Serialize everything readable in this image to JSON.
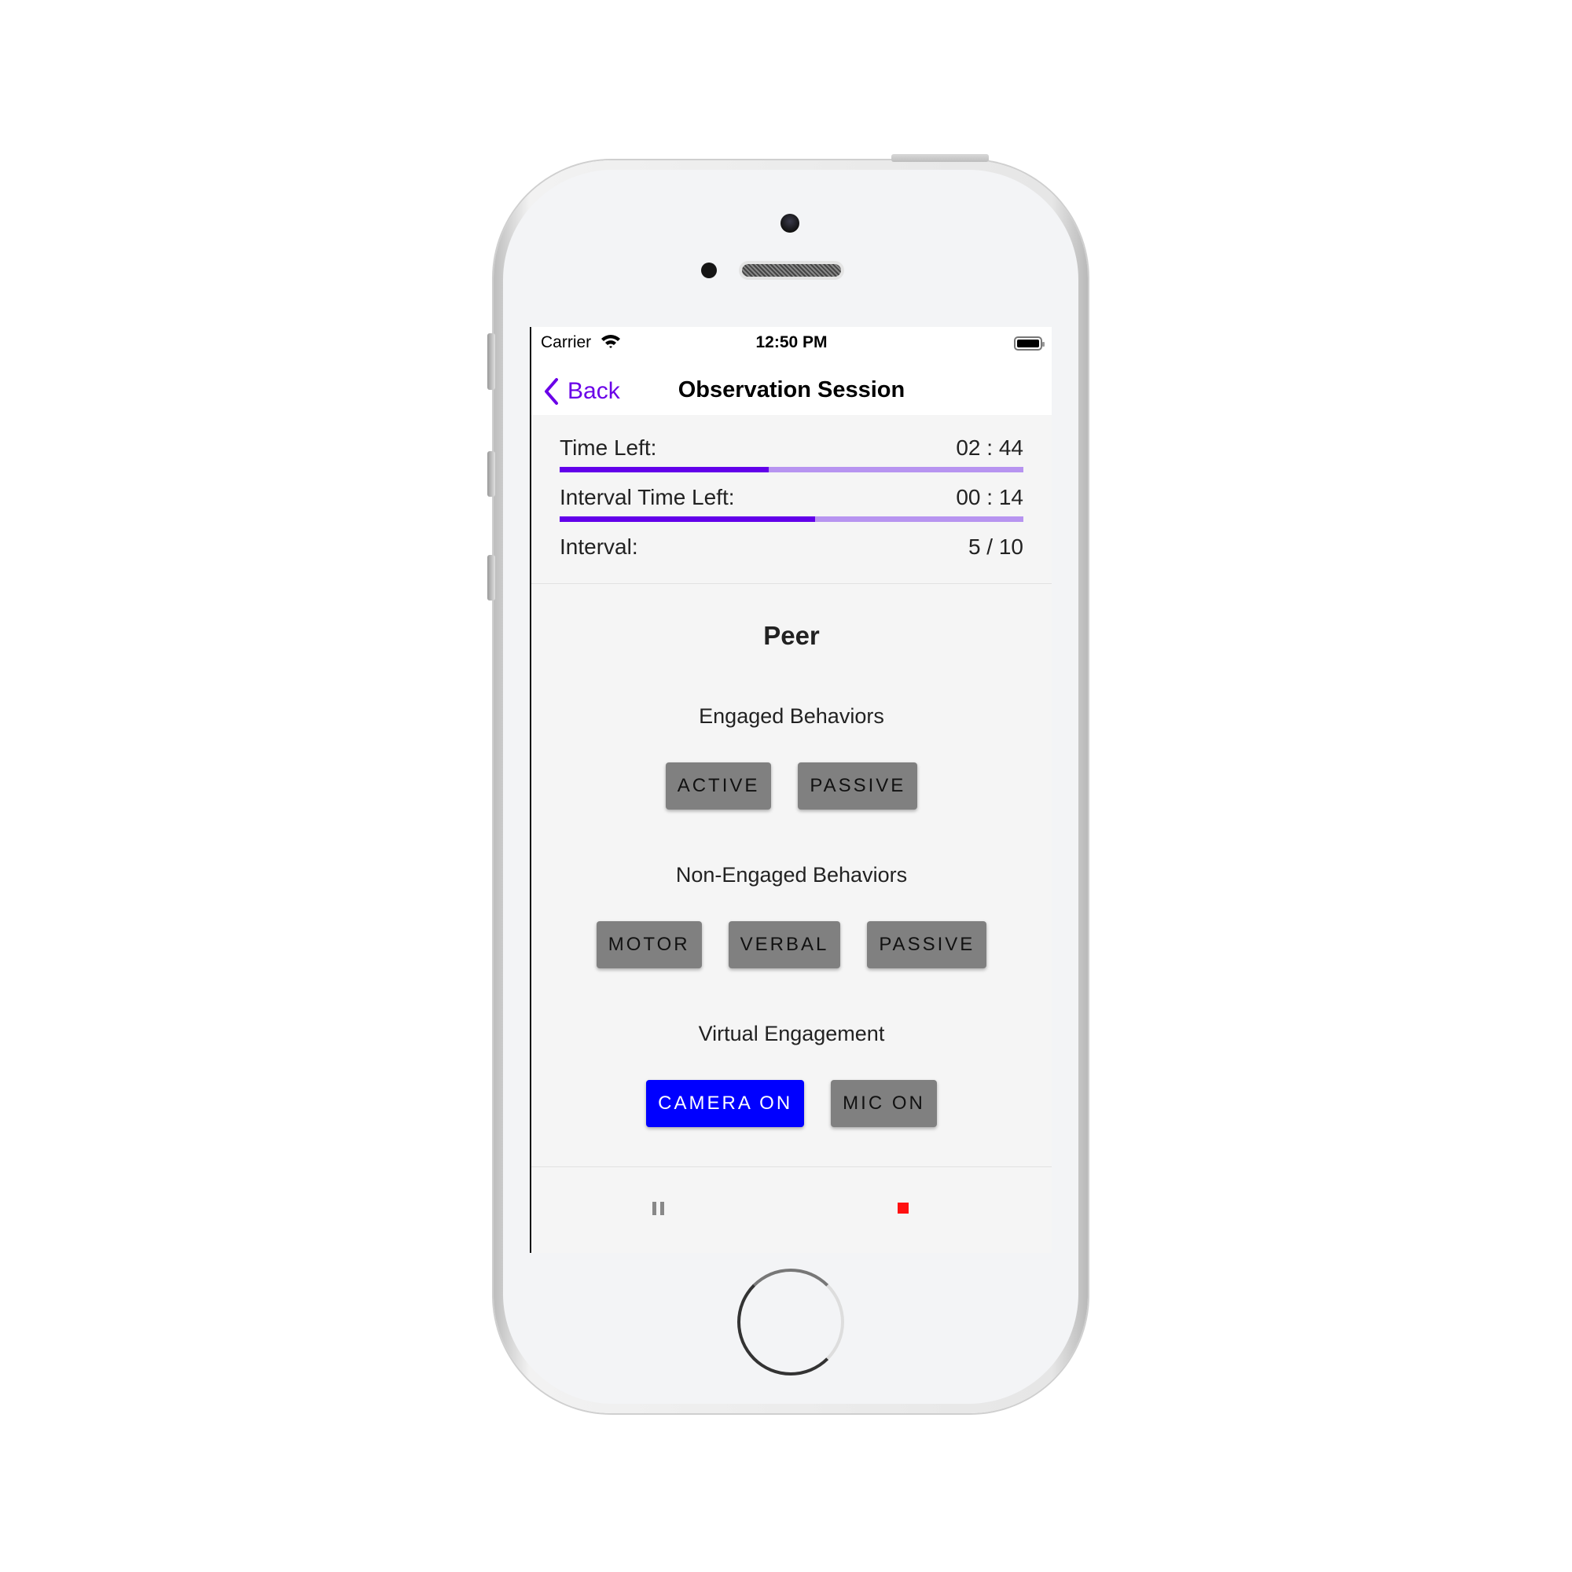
{
  "status_bar": {
    "carrier": "Carrier",
    "time": "12:50 PM",
    "wifi_icon": "wifi-icon",
    "battery_icon": "battery-icon"
  },
  "nav": {
    "back_label": "Back",
    "title": "Observation Session"
  },
  "timers": {
    "time_left_label": "Time Left:",
    "time_left_value": "02 : 44",
    "time_left_progress": 0.45,
    "interval_time_left_label": "Interval Time Left:",
    "interval_time_left_value": "00 : 14",
    "interval_progress": 0.55,
    "interval_label": "Interval:",
    "interval_value": "5 / 10"
  },
  "subject": "Peer",
  "sections": {
    "engaged": {
      "title": "Engaged Behaviors",
      "buttons": [
        "ACTIVE",
        "PASSIVE"
      ]
    },
    "non_engaged": {
      "title": "Non-Engaged Behaviors",
      "buttons": [
        "MOTOR",
        "VERBAL",
        "PASSIVE"
      ]
    },
    "virtual": {
      "title": "Virtual Engagement",
      "buttons": [
        "CAMERA ON",
        "MIC ON"
      ],
      "active_button": "CAMERA ON"
    }
  },
  "controls": {
    "pause_icon": "pause-icon",
    "stop_icon": "stop-icon"
  },
  "colors": {
    "accent": "#6200ea",
    "progress_track": "#b794f0",
    "active_button": "#0000ff",
    "inactive_button": "#808080",
    "stop": "#ff1010"
  }
}
